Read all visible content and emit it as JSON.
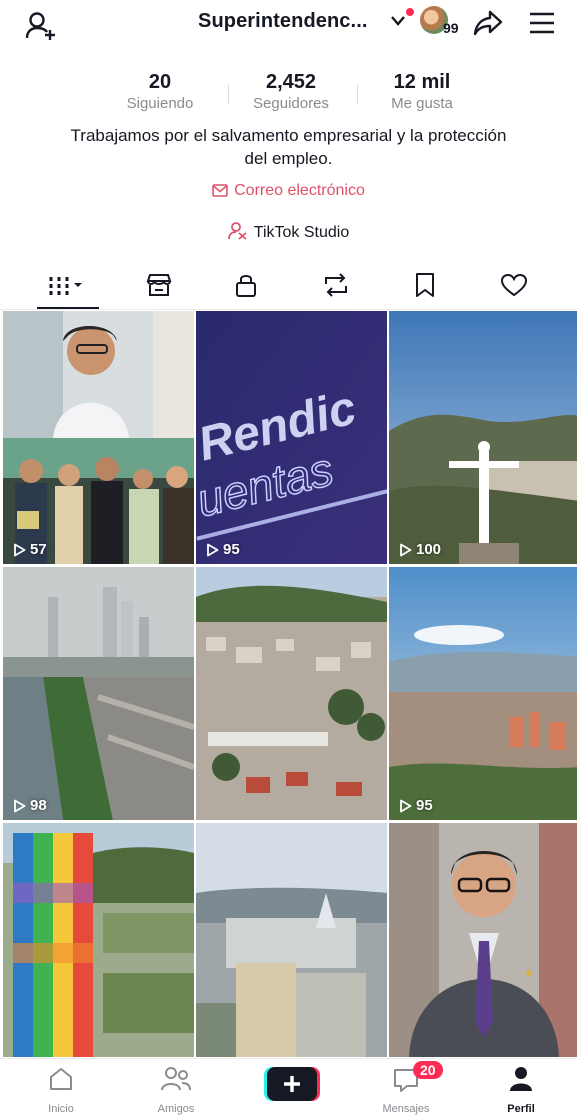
{
  "header": {
    "username": "Superintendenc...",
    "notif_count": "99",
    "icons": [
      "add-user-icon",
      "chevron-down-icon",
      "share-icon",
      "menu-icon"
    ]
  },
  "stats": {
    "following": {
      "value": "20",
      "label": "Siguiendo"
    },
    "followers": {
      "value": "2,452",
      "label": "Seguidores"
    },
    "likes": {
      "value": "12 mil",
      "label": "Me gusta"
    }
  },
  "bio": "Trabajamos por el salvamento empresarial y la protección del empleo.",
  "email_label": "Correo electrónico",
  "studio_label": "TikTok Studio",
  "tabs": [
    "videos-grid-icon",
    "shop-icon",
    "lock-icon",
    "repost-icon",
    "bookmark-icon",
    "heart-icon"
  ],
  "videos": [
    {
      "views": "57"
    },
    {
      "views": "95",
      "overlay_text": "Rendic"
    },
    {
      "views": "100"
    },
    {
      "views": "98"
    },
    {
      "views": ""
    },
    {
      "views": "95"
    },
    {
      "views": ""
    },
    {
      "views": ""
    },
    {
      "views": ""
    }
  ],
  "nav": {
    "home": "Inicio",
    "friends": "Amigos",
    "inbox": "Mensajes",
    "inbox_badge": "20",
    "profile": "Perfil"
  },
  "colors": {
    "accent": "#fe2c55",
    "link": "#e0506a",
    "muted": "#8a8b91"
  }
}
